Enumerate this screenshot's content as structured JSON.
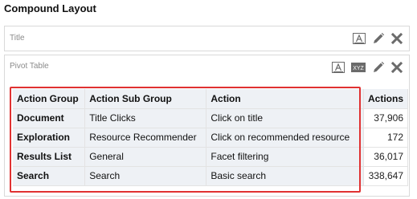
{
  "heading": "Compound Layout",
  "title_view": {
    "label": "Title",
    "tools": [
      "format-text-icon",
      "edit-pencil-icon",
      "delete-x-icon"
    ]
  },
  "pivot_view": {
    "label": "Pivot Table",
    "tools": [
      "format-text-icon",
      "xyz-icon",
      "edit-pencil-icon",
      "delete-x-icon"
    ],
    "xyz_text": "XYZ",
    "columns": [
      "Action Group",
      "Action Sub Group",
      "Action",
      "Actions"
    ],
    "rows": [
      {
        "group": "Document",
        "subgroup": "Title Clicks",
        "action": "Click on title",
        "actions": "37,906"
      },
      {
        "group": "Exploration",
        "subgroup": "Resource Recommender",
        "action": "Click on recommended resource",
        "actions": "172"
      },
      {
        "group": "Results List",
        "subgroup": "General",
        "action": "Facet filtering",
        "actions": "36,017"
      },
      {
        "group": "Search",
        "subgroup": "Search",
        "action": "Basic search",
        "actions": "338,647"
      }
    ]
  },
  "colors": {
    "highlight": "#e03232",
    "header_bg": "#eef1f5",
    "border": "#d9d9d9",
    "icon": "#6b6b6b"
  }
}
